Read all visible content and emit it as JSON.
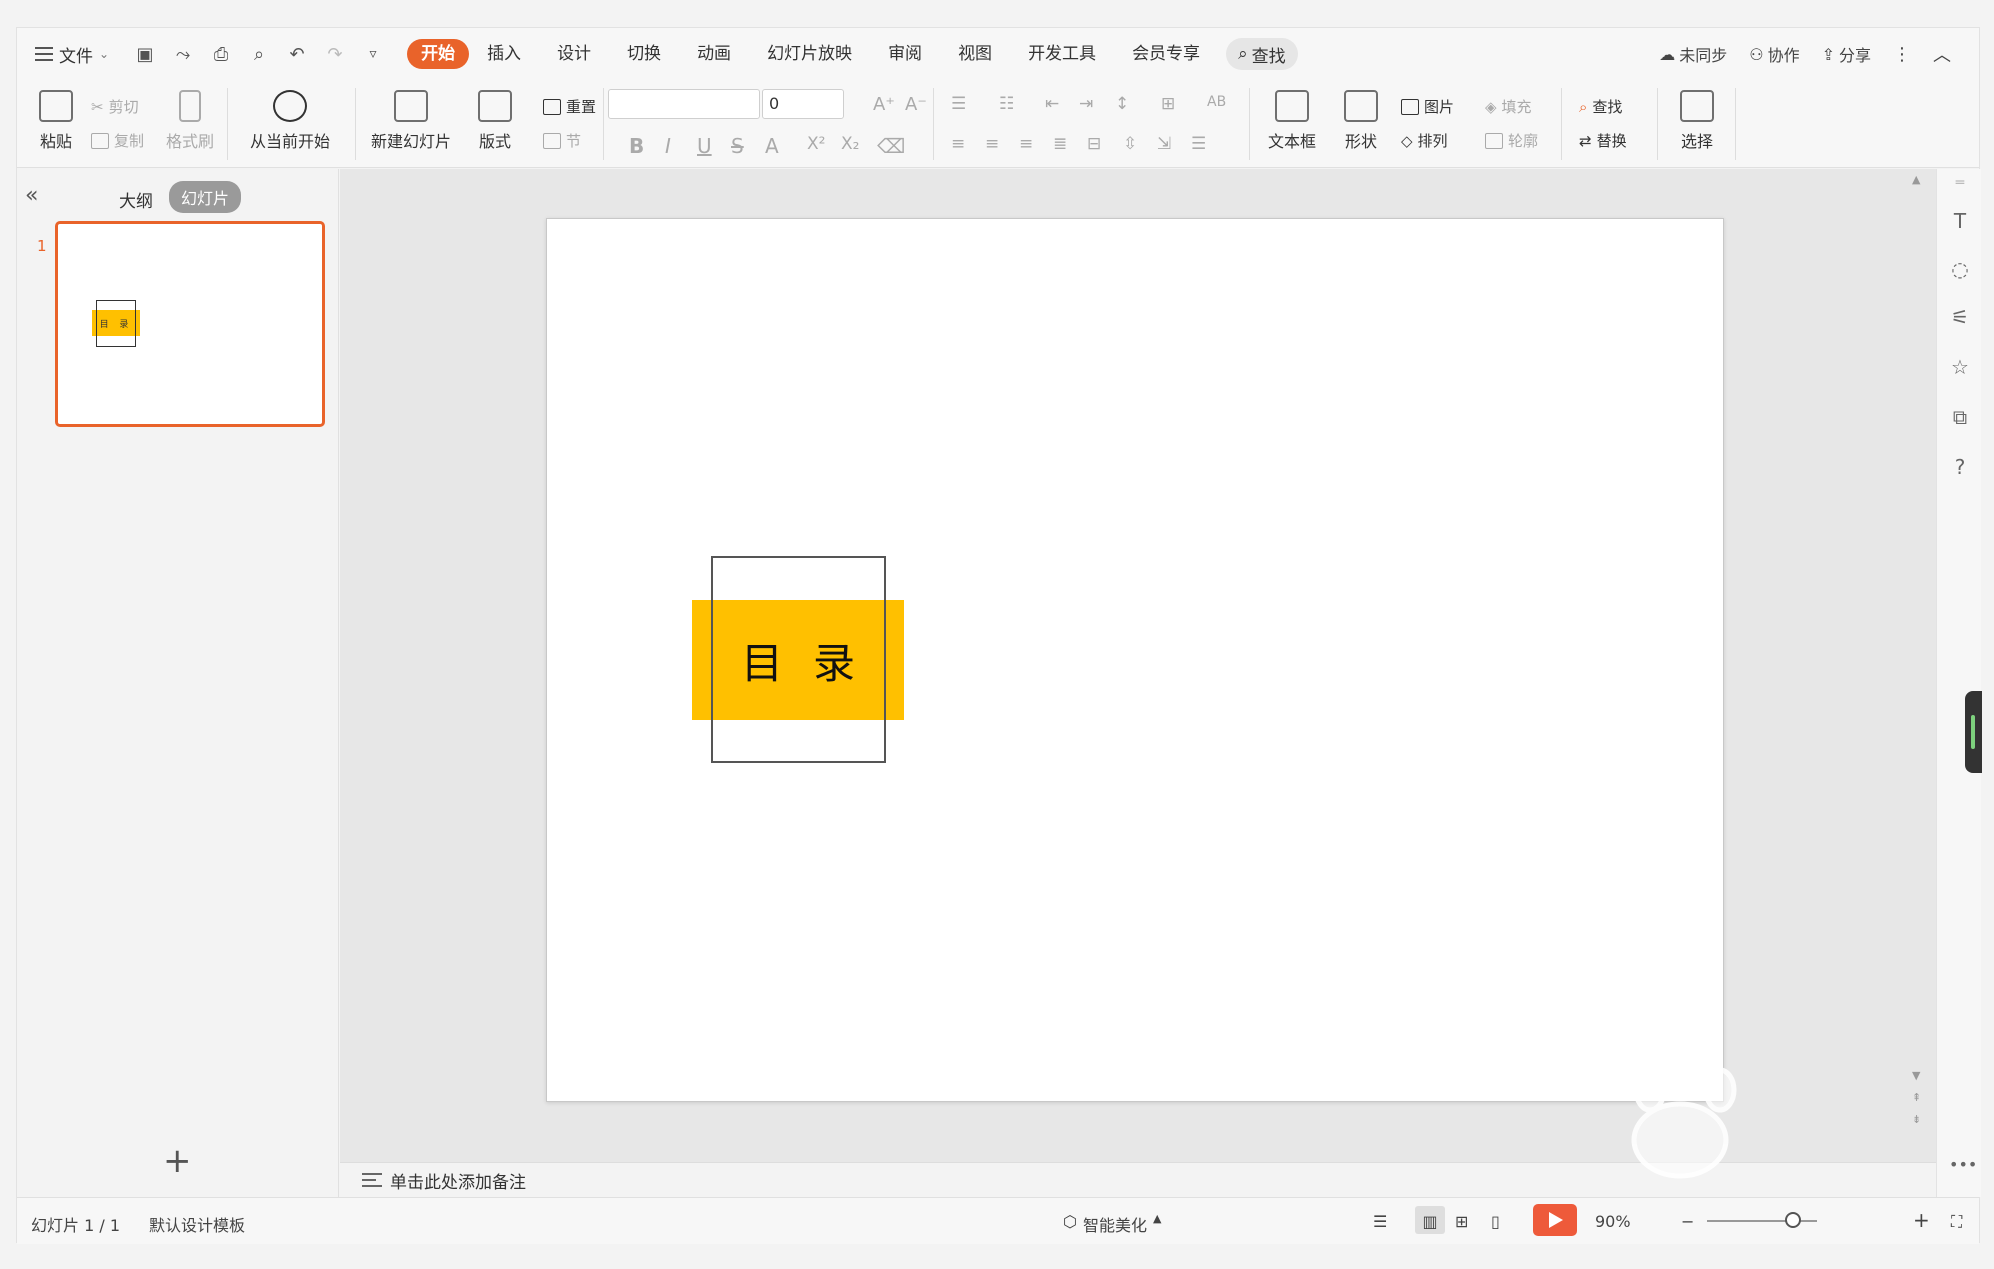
{
  "menubar": {
    "file_label": "文件",
    "tabs": [
      {
        "label": "开始",
        "active": true
      },
      {
        "label": "插入"
      },
      {
        "label": "设计"
      },
      {
        "label": "切换"
      },
      {
        "label": "动画"
      },
      {
        "label": "幻灯片放映"
      },
      {
        "label": "审阅"
      },
      {
        "label": "视图"
      },
      {
        "label": "开发工具"
      },
      {
        "label": "会员专享"
      }
    ],
    "search_label": "查找",
    "sync_label": "未同步",
    "collab_label": "协作",
    "share_label": "分享"
  },
  "ribbon": {
    "paste": "粘贴",
    "cut": "剪切",
    "copy": "复制",
    "format_painter": "格式刷",
    "from_current": "从当前开始",
    "new_slide": "新建幻灯片",
    "layout": "版式",
    "reset": "重置",
    "section": "节",
    "font_name": "",
    "font_size": "0",
    "text_box": "文本框",
    "shape": "形状",
    "picture": "图片",
    "fill": "填充",
    "arrange": "排列",
    "outline": "轮廓",
    "find": "查找",
    "replace": "替换",
    "select": "选择"
  },
  "leftpane": {
    "outline_tab": "大纲",
    "slides_tab": "幻灯片",
    "slide_number": "1",
    "thumb_text": "目 录"
  },
  "slide": {
    "toc_text": "目录"
  },
  "notes": {
    "placeholder": "单击此处添加备注"
  },
  "statusbar": {
    "slide_counter": "幻灯片 1 / 1",
    "template": "默认设计模板",
    "smart_beautify": "智能美化",
    "zoom": "90%"
  },
  "colors": {
    "accent": "#e9632a",
    "toc_band": "#ffc000"
  }
}
